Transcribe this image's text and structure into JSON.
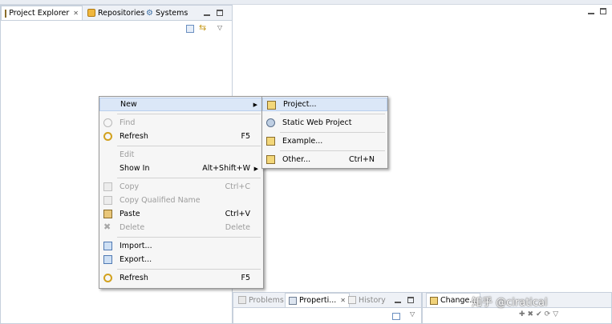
{
  "left_panel": {
    "tabs": [
      {
        "label": "Project Explorer",
        "icon": "project-explorer-icon",
        "active": true
      },
      {
        "label": "Repositories",
        "icon": "repositories-icon",
        "active": false
      },
      {
        "label": "Systems",
        "icon": "systems-icon",
        "active": false
      }
    ]
  },
  "context_menu": {
    "items": [
      {
        "label": "New",
        "shortcut": "",
        "submenu": true,
        "enabled": true,
        "highlighted": true,
        "icon": ""
      },
      {
        "label": "Find",
        "shortcut": "",
        "enabled": false,
        "icon": "find-icon"
      },
      {
        "label": "Refresh",
        "shortcut": "F5",
        "enabled": true,
        "icon": "refresh-icon"
      },
      {
        "label": "Edit",
        "shortcut": "",
        "enabled": false,
        "icon": ""
      },
      {
        "label": "Show In",
        "shortcut": "Alt+Shift+W",
        "submenu": true,
        "enabled": true,
        "icon": ""
      },
      {
        "label": "Copy",
        "shortcut": "Ctrl+C",
        "enabled": false,
        "icon": "copy-icon"
      },
      {
        "label": "Copy Qualified Name",
        "shortcut": "",
        "enabled": false,
        "icon": "copy-qualified-name-icon"
      },
      {
        "label": "Paste",
        "shortcut": "Ctrl+V",
        "enabled": true,
        "icon": "paste-icon"
      },
      {
        "label": "Delete",
        "shortcut": "Delete",
        "enabled": false,
        "icon": "delete-icon"
      },
      {
        "label": "Import...",
        "shortcut": "",
        "enabled": true,
        "icon": "import-icon"
      },
      {
        "label": "Export...",
        "shortcut": "",
        "enabled": true,
        "icon": "export-icon"
      },
      {
        "label": "Refresh",
        "shortcut": "F5",
        "enabled": true,
        "icon": "refresh-icon"
      }
    ]
  },
  "submenu_new": {
    "items": [
      {
        "label": "Project...",
        "shortcut": "",
        "icon": "new-project-icon",
        "highlighted": true
      },
      {
        "label": "Static Web Project",
        "shortcut": "",
        "icon": "static-web-project-icon"
      },
      {
        "label": "Example...",
        "shortcut": "",
        "icon": "example-icon"
      },
      {
        "label": "Other...",
        "shortcut": "Ctrl+N",
        "icon": "other-wizard-icon"
      }
    ]
  },
  "bottom_panel": {
    "tabs": [
      {
        "label": "Problems",
        "active": false
      },
      {
        "label": "Properti...",
        "active": true
      },
      {
        "label": "History",
        "active": false
      }
    ]
  },
  "bottom_right_panel": {
    "tabs": [
      {
        "label": "Change...",
        "active": true
      }
    ]
  },
  "watermark": {
    "text": "知乎 @ciratical"
  },
  "colors": {
    "menu_highlight": "#dbe7f7",
    "panel_border": "#c7d0dc",
    "tabbar_bg": "#eef1f6",
    "disabled_text": "#9c9c9c"
  }
}
